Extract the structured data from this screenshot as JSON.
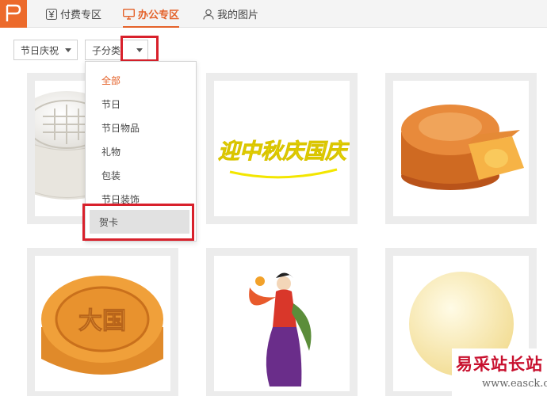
{
  "tabs": [
    {
      "label": "付费专区",
      "icon": "yen-icon"
    },
    {
      "label": "办公专区",
      "icon": "monitor-icon",
      "active": true
    },
    {
      "label": "我的图片",
      "icon": "user-icon"
    }
  ],
  "filters": {
    "festival": {
      "value": "节日庆祝"
    },
    "sub": {
      "value": "子分类"
    }
  },
  "dropdown": {
    "items": [
      "全部",
      "节日",
      "节日物品",
      "礼物",
      "包装",
      "节日装饰",
      "贺卡"
    ],
    "selected_index": 0,
    "hover_index": 6
  },
  "cards": [
    {
      "image": "white-mooncake"
    },
    {
      "image": "mid-autumn-calligraphy",
      "text": "迎中秋庆国庆"
    },
    {
      "image": "cut-mooncake"
    },
    {
      "image": "golden-mooncake",
      "text": "大国"
    },
    {
      "image": "changee-figure"
    },
    {
      "image": "pale-moon"
    }
  ],
  "watermark": {
    "title": "易采站长站",
    "url": "www.easck.com"
  },
  "colors": {
    "accent": "#e4622a",
    "logo": "#ec6a2b",
    "highlight_box": "#d8202b"
  }
}
